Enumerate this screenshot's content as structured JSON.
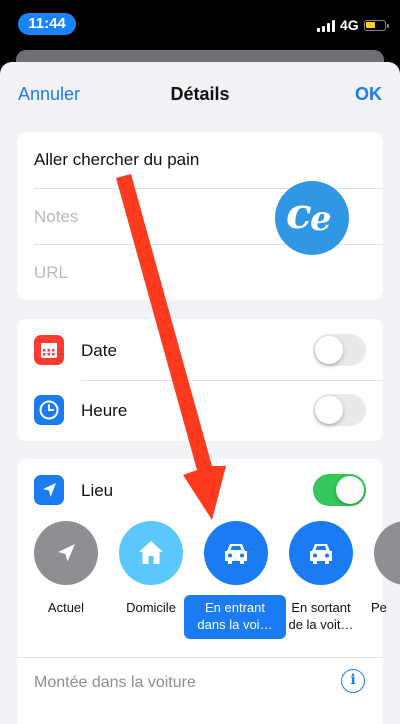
{
  "status_bar": {
    "time": "11:44",
    "network": "4G"
  },
  "nav": {
    "cancel": "Annuler",
    "title": "Détails",
    "ok": "OK"
  },
  "reminder": {
    "title": "Aller chercher du pain",
    "notes_placeholder": "Notes",
    "url_placeholder": "URL"
  },
  "watermark": {
    "logo_text": "ce"
  },
  "date_row": {
    "label": "Date",
    "icon": "calendar-icon",
    "toggle": "off"
  },
  "time_row": {
    "label": "Heure",
    "icon": "clock-icon",
    "toggle": "off"
  },
  "location": {
    "label": "Lieu",
    "icon": "location-arrow-icon",
    "toggle": "on",
    "options": [
      {
        "label": "Actuel",
        "icon": "location-arrow-icon",
        "color": "#8e8e93"
      },
      {
        "label": "Domicile",
        "icon": "house-icon",
        "color": "#5ac8fa"
      },
      {
        "label_line1": "En entrant",
        "label_line2": "dans la voi…",
        "icon": "car-icon",
        "color": "#1a7bf2",
        "selected": true
      },
      {
        "label_line1": "En sortant",
        "label_line2": "de la voit…",
        "icon": "car-icon",
        "color": "#1a7bf2"
      },
      {
        "label": "Pe",
        "color": "#8e8e93"
      }
    ],
    "footer": "Montée dans la voiture"
  },
  "colors": {
    "accent": "#1a7bf2",
    "toggle_on": "#34c759",
    "annotation_arrow": "#ff3b1f"
  }
}
